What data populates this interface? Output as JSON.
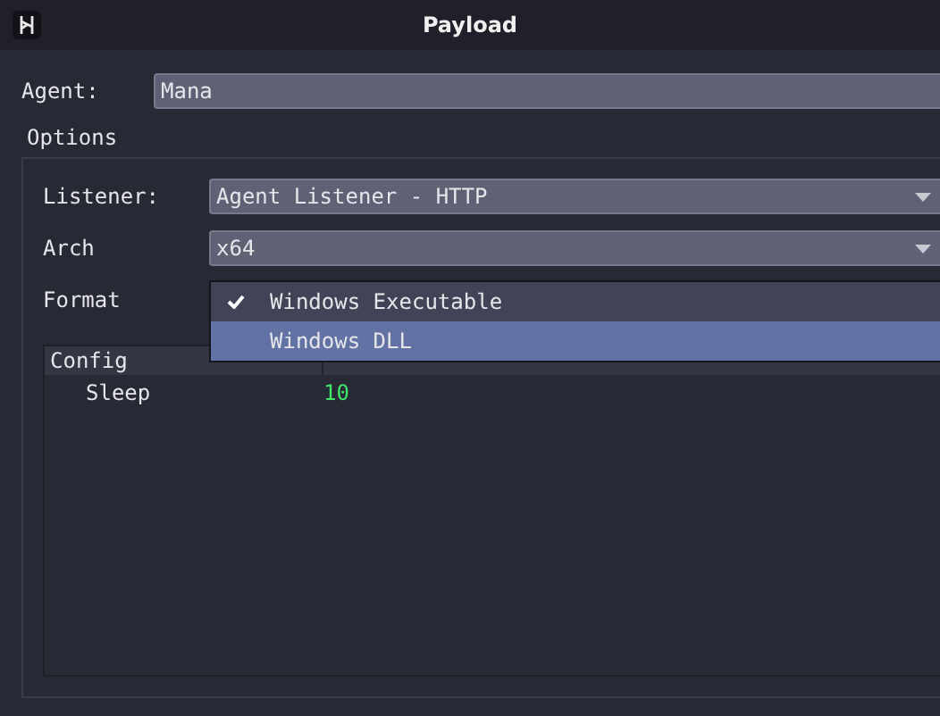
{
  "window": {
    "title": "Payload"
  },
  "agent": {
    "label": "Agent:",
    "value": "Mana"
  },
  "options": {
    "title": "Options",
    "fields": [
      {
        "label": "Listener:",
        "value": "Agent Listener - HTTP"
      },
      {
        "label": "Arch",
        "value": "x64"
      },
      {
        "label": "Format"
      }
    ],
    "format_menu": [
      {
        "label": "Windows Executable",
        "checked": true,
        "selected": false
      },
      {
        "label": "Windows DLL",
        "checked": false,
        "selected": true
      }
    ],
    "config_table": {
      "columns": [
        "Config"
      ],
      "rows": [
        {
          "name": "Sleep",
          "value": "10"
        }
      ]
    }
  }
}
